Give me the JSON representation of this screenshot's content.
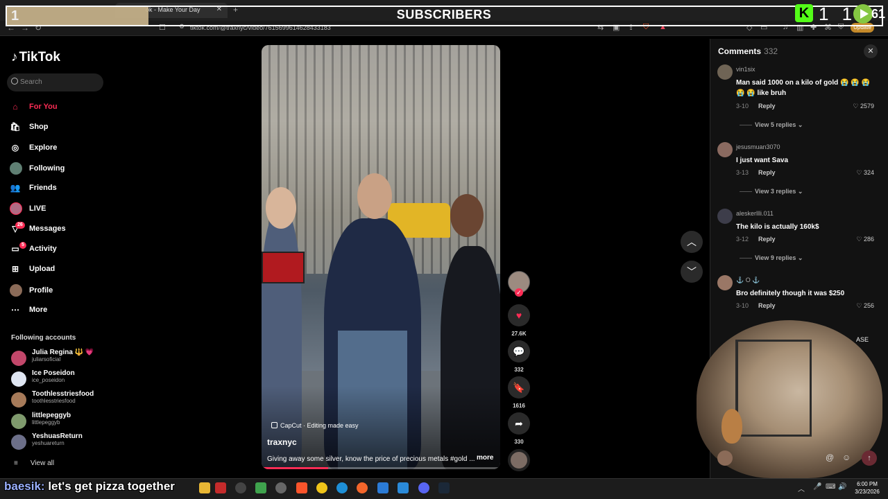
{
  "browser": {
    "tab_title": "ok - Make Your Day",
    "tab_close": "✕",
    "new_tab": "+",
    "url": "tiktok.com/@traxnyc/video/7615699614628433183",
    "update_label": "Update"
  },
  "overlay": {
    "goal_number": "1",
    "title": "SUBSCRIBERS",
    "kick_logo": "K",
    "kick_count": "1 1",
    "rumble_count": "61"
  },
  "tiktok": {
    "logo": "TikTok",
    "search_placeholder": "Search",
    "nav": [
      {
        "label": "For You",
        "icon": "home-icon",
        "active": true
      },
      {
        "label": "Shop",
        "icon": "shop-icon"
      },
      {
        "label": "Explore",
        "icon": "compass-icon"
      },
      {
        "label": "Following",
        "icon": "avatar"
      },
      {
        "label": "Friends",
        "icon": "friends-icon"
      },
      {
        "label": "LIVE",
        "icon": "avatar"
      },
      {
        "label": "Messages",
        "icon": "messages-icon",
        "badge": "26"
      },
      {
        "label": "Activity",
        "icon": "activity-icon",
        "badge": "5"
      },
      {
        "label": "Upload",
        "icon": "upload-icon"
      },
      {
        "label": "Profile",
        "icon": "avatar"
      },
      {
        "label": "More",
        "icon": "more-icon"
      }
    ],
    "following_title": "Following accounts",
    "following": [
      {
        "name": "Julia Regina 🔱 💗",
        "handle": "juliarsoficial"
      },
      {
        "name": "Ice Poseidon",
        "handle": "ice_poseidon"
      },
      {
        "name": "Toothlesstriesfood",
        "handle": "toothlesstriesfood"
      },
      {
        "name": "littlepeggyb",
        "handle": "littlepeggyb"
      },
      {
        "name": "YeshuasReturn",
        "handle": "yeshuareturn"
      }
    ],
    "view_all": "View all"
  },
  "video": {
    "capcut": "CapCut · Editing made easy",
    "author": "traxnyc",
    "description": "Giving away some silver, know the price of precious metals #gold ...",
    "more": "more",
    "progress": 0.28
  },
  "actions": {
    "likes": "27.6K",
    "comments": "332",
    "saves": "1616",
    "shares": "330"
  },
  "comments": {
    "title": "Comments",
    "count": "332",
    "items": [
      {
        "user": "vin1six",
        "text": "Man said 1000 on a kilo of gold 😭 😭 😭 😭 😭 like bruh",
        "date": "3-10",
        "reply": "Reply",
        "likes": "2579",
        "view_replies": "View 5 replies ⌄"
      },
      {
        "user": "jesusmuan3070",
        "text": "I just want Sava",
        "date": "3-13",
        "reply": "Reply",
        "likes": "324",
        "view_replies": "View 3 replies ⌄"
      },
      {
        "user": "aleskerllli.011",
        "text": "The kilo is actually 160k$",
        "date": "3-12",
        "reply": "Reply",
        "likes": "286",
        "view_replies": "View 9 replies ⌄"
      },
      {
        "user": "⚓ O ⚓",
        "text": "Bro definitely though it was $250",
        "date": "3-10",
        "reply": "Reply",
        "likes": "256"
      }
    ],
    "cam_text": "ASE"
  },
  "taskbar": {
    "caption_user": "baesik:",
    "caption_text": " let's get pizza together",
    "time": "6:00 PM",
    "date": "3/23/2026"
  },
  "colors": {
    "accent": "#fe2c55",
    "kick": "#53fc18",
    "rumble": "#85c742"
  }
}
